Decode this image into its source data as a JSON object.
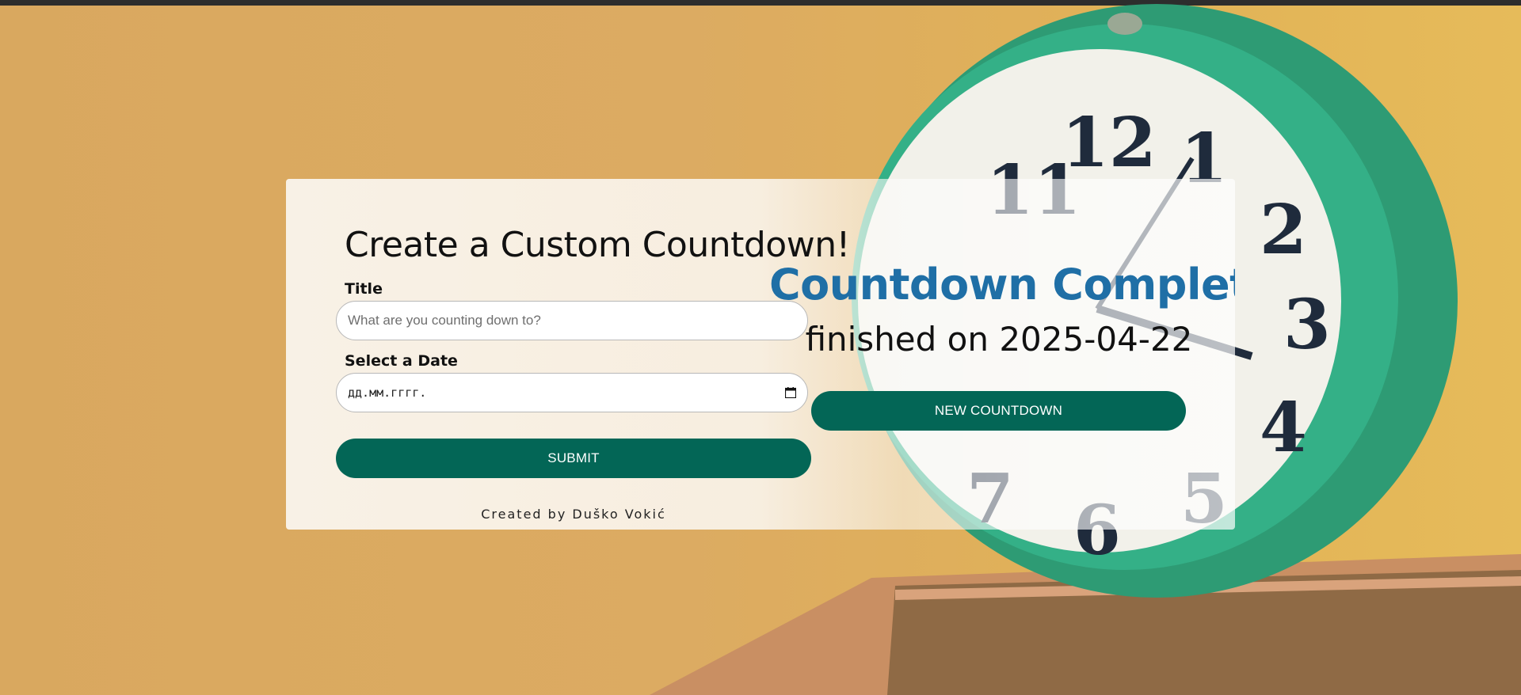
{
  "form": {
    "heading": "Create a Custom Countdown!",
    "title_label": "Title",
    "title_placeholder": "What are you counting down to?",
    "date_label": "Select a Date",
    "date_placeholder": "дд.мм.гггг.",
    "submit_label": "SUBMIT",
    "credit": "Created by Duško Vokić"
  },
  "complete": {
    "title": "Countdown Complete!",
    "finished_text": "finished on 2025-04-22",
    "new_button_label": "NEW COUNTDOWN"
  },
  "colors": {
    "accent_button": "#036656",
    "complete_title": "#1f6fa6",
    "background": "#dcab62"
  },
  "icons": {
    "date_picker": "calendar-icon"
  }
}
